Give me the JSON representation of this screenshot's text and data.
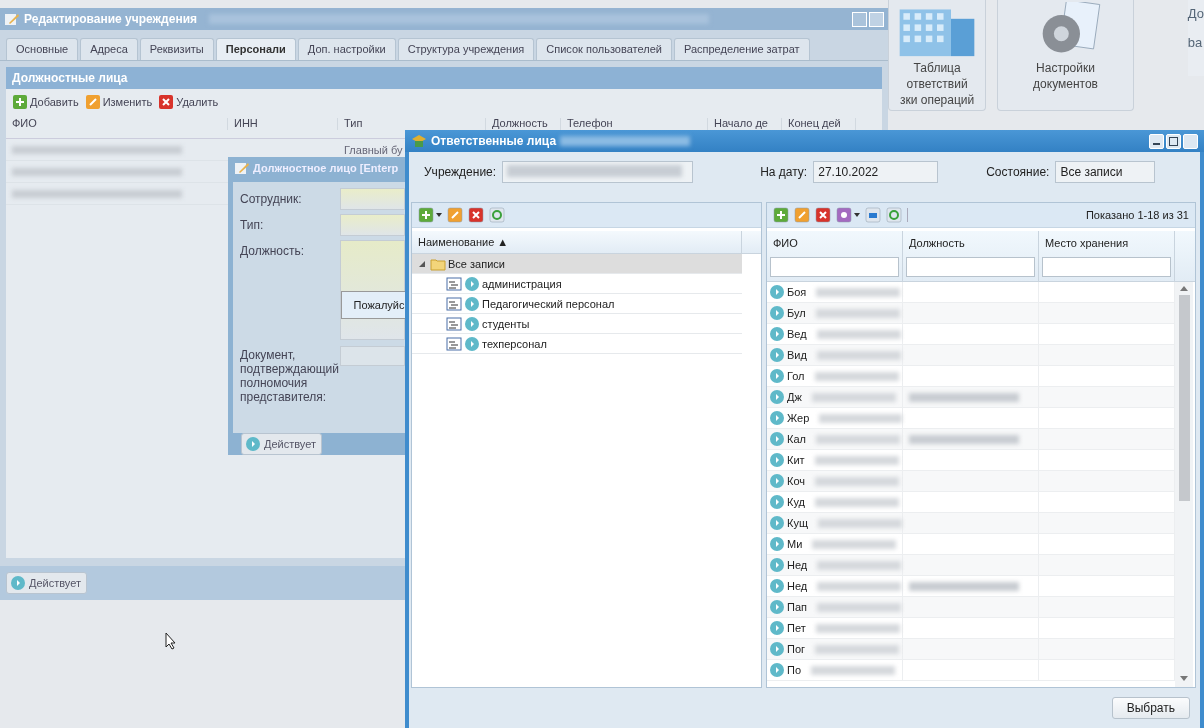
{
  "desktop": {
    "tiles": [
      {
        "kind": "building",
        "lines": [
          "Таблица",
          "ответствий",
          "зки операций"
        ]
      },
      {
        "kind": "gear",
        "lines": [
          "Настройки",
          "документов"
        ]
      }
    ],
    "side_texts": [
      "До",
      "ba"
    ]
  },
  "main_window": {
    "title": "Редактирование учреждения",
    "tabs": [
      {
        "label": "Основные",
        "selected": false
      },
      {
        "label": "Адреса",
        "selected": false
      },
      {
        "label": "Реквизиты",
        "selected": false
      },
      {
        "label": "Персонали",
        "selected": true
      },
      {
        "label": "Доп. настройки",
        "selected": false
      },
      {
        "label": "Структура учреждения",
        "selected": false
      },
      {
        "label": "Список пользователей",
        "selected": false
      },
      {
        "label": "Распределение затрат",
        "selected": false
      }
    ],
    "panel_title": "Должностные лица",
    "toolbar": [
      {
        "kind": "add",
        "label": "Добавить"
      },
      {
        "kind": "edit",
        "label": "Изменить"
      },
      {
        "kind": "delete",
        "label": "Удалить"
      }
    ],
    "columns": [
      "ФИО",
      "ИНН",
      "Тип",
      "Должность",
      "Телефон",
      "Начало де",
      "Конец дей"
    ],
    "rows": [
      {
        "type": "Главный бу"
      },
      {
        "type": ""
      },
      {
        "type": ""
      }
    ],
    "footer_button": "Действует"
  },
  "dialog": {
    "title": "Должностное лицо [Enterp",
    "fields": [
      {
        "kind": "input",
        "label": "Сотрудник:"
      },
      {
        "kind": "input",
        "label": "Тип:"
      },
      {
        "kind": "textarea",
        "label": "Должность:",
        "popup": "Пожалуйс"
      },
      {
        "kind": "plain",
        "label": "Документ, подтверждающий полномочия представителя:"
      }
    ],
    "button": "Действует"
  },
  "responsible_window": {
    "title": "Ответственные лица",
    "filters": [
      {
        "label": "Учреждение:",
        "kind": "blurred"
      },
      {
        "label": "На дату:",
        "kind": "text",
        "value": "27.10.2022"
      },
      {
        "label": "Состояние:",
        "kind": "text",
        "value": "Все записи"
      }
    ],
    "tree_toolbar": [
      {
        "kind": "add",
        "dropdown": true
      },
      {
        "kind": "edit",
        "dropdown": false
      },
      {
        "kind": "delete",
        "dropdown": false
      },
      {
        "kind": "refresh",
        "dropdown": false
      }
    ],
    "tree_header": "Наименование ▲",
    "tree": [
      {
        "label": "Все записи",
        "expanded": true,
        "selected": true,
        "children": [
          {
            "label": "администрация",
            "selected": false
          },
          {
            "label": "Педагогический персонал",
            "selected": false
          },
          {
            "label": "студенты",
            "selected": false
          },
          {
            "label": "техперсонал",
            "selected": false
          }
        ]
      }
    ],
    "grid_toolbar": [
      {
        "kind": "add",
        "dropdown": false
      },
      {
        "kind": "edit",
        "dropdown": false
      },
      {
        "kind": "delete",
        "dropdown": false
      },
      {
        "kind": "settings",
        "dropdown": true
      },
      {
        "kind": "print",
        "dropdown": false
      },
      {
        "kind": "refresh",
        "dropdown": false
      }
    ],
    "paging": "Показано 1-18 из 31",
    "columns": [
      "ФИО",
      "Должность",
      "Место хранения"
    ],
    "rows": [
      {
        "fio": "Боя",
        "position_blurred": false
      },
      {
        "fio": "Бул",
        "position_blurred": false
      },
      {
        "fio": "Вед",
        "position_blurred": false
      },
      {
        "fio": "Вид",
        "position_blurred": false
      },
      {
        "fio": "Гол",
        "position_blurred": false
      },
      {
        "fio": "Дж",
        "position_blurred": true
      },
      {
        "fio": "Жер",
        "position_blurred": false
      },
      {
        "fio": "Кал",
        "position_blurred": true
      },
      {
        "fio": "Кит",
        "position_blurred": false
      },
      {
        "fio": "Коч",
        "position_blurred": false
      },
      {
        "fio": "Куд",
        "position_blurred": false
      },
      {
        "fio": "Кущ",
        "position_blurred": false
      },
      {
        "fio": "Ми",
        "position_blurred": false
      },
      {
        "fio": "Нед",
        "position_blurred": false
      },
      {
        "fio": "Нед",
        "position_blurred": true
      },
      {
        "fio": "Пап",
        "position_blurred": false
      },
      {
        "fio": "Пет",
        "position_blurred": false
      },
      {
        "fio": "Пог",
        "position_blurred": false
      },
      {
        "fio": "По",
        "position_blurred": false
      }
    ],
    "select_button": "Выбрать"
  }
}
